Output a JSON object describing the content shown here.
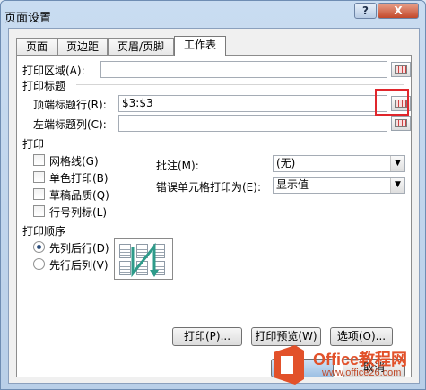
{
  "window": {
    "title": "页面设置",
    "help_label": "?",
    "close_label": "X"
  },
  "tabs": [
    {
      "label": "页面"
    },
    {
      "label": "页边距"
    },
    {
      "label": "页眉/页脚"
    },
    {
      "label": "工作表"
    }
  ],
  "print_area": {
    "label": "打印区域(A):",
    "value": ""
  },
  "print_titles": {
    "heading": "打印标题",
    "rows": {
      "label": "顶端标题行(R):",
      "value": "$3:$3"
    },
    "cols": {
      "label": "左端标题列(C):",
      "value": ""
    }
  },
  "print": {
    "heading": "打印",
    "checkboxes": [
      {
        "label": "网格线(G)",
        "checked": false
      },
      {
        "label": "单色打印(B)",
        "checked": false
      },
      {
        "label": "草稿品质(Q)",
        "checked": false
      },
      {
        "label": "行号列标(L)",
        "checked": false
      }
    ],
    "comments": {
      "label": "批注(M):",
      "value": "(无)"
    },
    "cell_errors": {
      "label": "错误单元格打印为(E):",
      "value": "显示值"
    }
  },
  "order": {
    "heading": "打印顺序",
    "options": [
      {
        "label": "先列后行(D)",
        "selected": true
      },
      {
        "label": "先行后列(V)",
        "selected": false
      }
    ]
  },
  "buttons": {
    "print": "打印(P)...",
    "preview": "打印预览(W)",
    "options": "选项(O)...",
    "cancel": "取消"
  },
  "watermark": {
    "title": "Office教程网",
    "url": "www.office26.com"
  },
  "colors": {
    "highlight": "#e0262c",
    "accent": "#e2512a"
  }
}
